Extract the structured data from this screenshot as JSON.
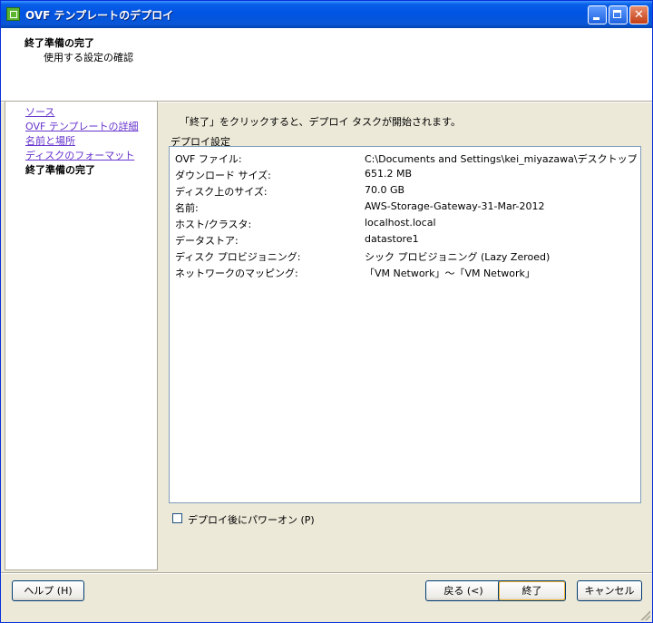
{
  "window": {
    "title": "OVF テンプレートのデプロイ",
    "icon": "vsphere-app-icon"
  },
  "header": {
    "title": "終了準備の完了",
    "subtitle": "使用する設定の確認"
  },
  "nav": {
    "items": [
      {
        "label": "ソース",
        "link": true
      },
      {
        "label": "OVF テンプレートの詳細",
        "link": true
      },
      {
        "label": "名前と場所",
        "link": true
      },
      {
        "label": "ディスクのフォーマット",
        "link": true
      },
      {
        "label": "終了準備の完了",
        "link": false,
        "current": true
      }
    ]
  },
  "main": {
    "instruction": "「終了」をクリックすると、デプロイ タスクが開始されます。",
    "group_label": "デプロイ設定",
    "settings": [
      {
        "label": "OVF ファイル:",
        "value": "C:\\Documents and Settings\\kei_miyazawa\\デスクトップ\\A..."
      },
      {
        "label": "ダウンロード サイズ:",
        "value": "651.2 MB"
      },
      {
        "label": "ディスク上のサイズ:",
        "value": "70.0 GB"
      },
      {
        "label": "名前:",
        "value": "AWS-Storage-Gateway-31-Mar-2012"
      },
      {
        "label": "ホスト/クラスタ:",
        "value": "localhost.local"
      },
      {
        "label": "データストア:",
        "value": "datastore1"
      },
      {
        "label": "ディスク プロビジョニング:",
        "value": "シック プロビジョニング (Lazy Zeroed)"
      },
      {
        "label": "ネットワークのマッピング:",
        "value": "「VM Network」〜「VM Network」"
      }
    ],
    "power_on_label": "デプロイ後にパワーオン (P)",
    "power_on_checked": false
  },
  "footer": {
    "help_label": "ヘルプ (H)",
    "back_label": "戻る (<)",
    "finish_label": "終了",
    "cancel_label": "キャンセル"
  }
}
